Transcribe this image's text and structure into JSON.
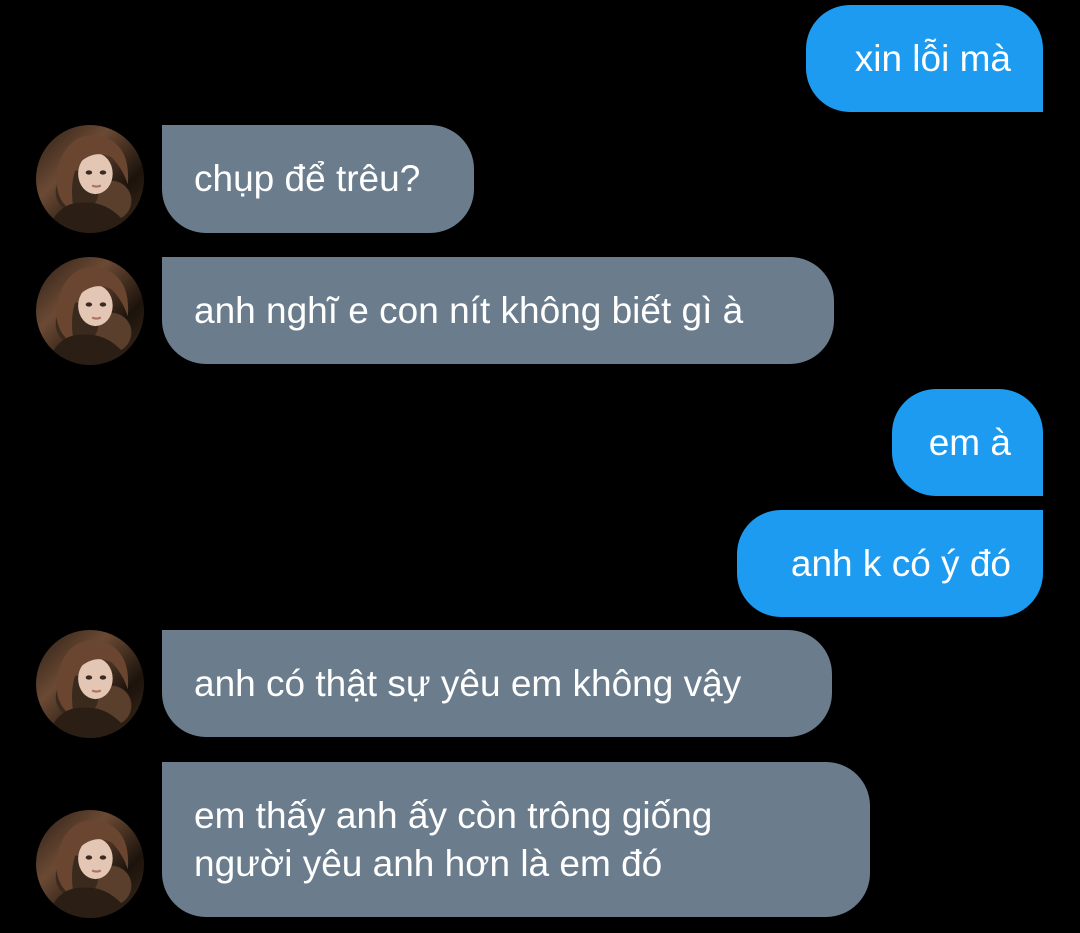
{
  "theme": {
    "background": "#000000",
    "outgoing_color": "#1d9bf0",
    "incoming_color": "#6b7d8d",
    "text_color": "#ffffff"
  },
  "messages": [
    {
      "direction": "outgoing",
      "text": "xin lỗi mà"
    },
    {
      "direction": "incoming",
      "text": "chụp để trêu?",
      "avatar": "contact-avatar"
    },
    {
      "direction": "incoming",
      "text": "anh nghĩ e con nít không biết gì à",
      "avatar": "contact-avatar"
    },
    {
      "direction": "outgoing",
      "text": "em à"
    },
    {
      "direction": "outgoing",
      "text": "anh k có ý đó"
    },
    {
      "direction": "incoming",
      "text": "anh có thật sự yêu em không vậy",
      "avatar": "contact-avatar"
    },
    {
      "direction": "incoming",
      "lines": [
        "em thấy anh ấy còn trông giống",
        "người yêu anh hơn là em đó"
      ],
      "avatar": "contact-avatar"
    }
  ]
}
